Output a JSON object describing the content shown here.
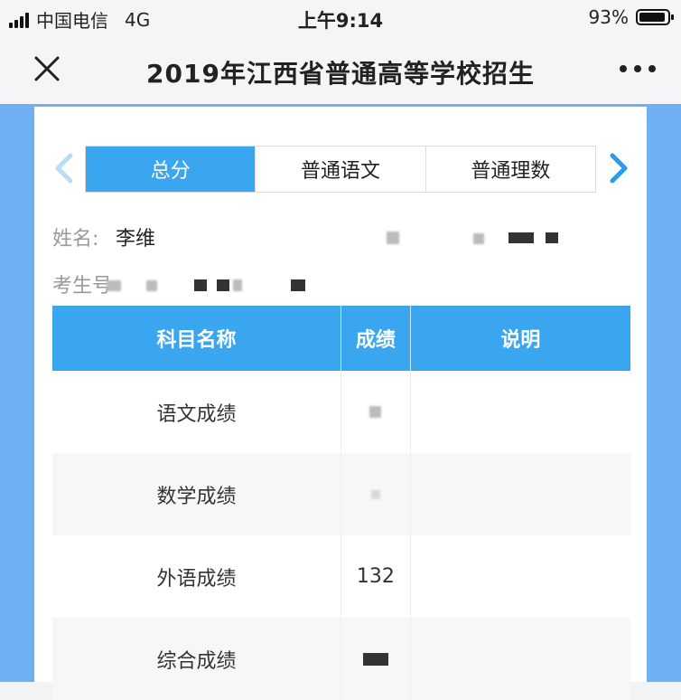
{
  "status_bar": {
    "carrier": "中国电信",
    "network": "4G",
    "time": "上午9:14",
    "battery": "93%",
    "battery_level": 0.93
  },
  "navbar": {
    "title": "2019年江西省普通高等学校招生",
    "close_icon": "close-icon",
    "more_icon": "more-icon"
  },
  "tabs": [
    "总分",
    "普通语文",
    "普通理数"
  ],
  "candidate": {
    "name_label": "姓名:",
    "name_value": "李维",
    "id_label": "考生号"
  },
  "table": {
    "headers": [
      "科目名称",
      "成绩",
      "说明"
    ],
    "rows": [
      {
        "subject": "语文成绩",
        "score": "",
        "note": ""
      },
      {
        "subject": "数学成绩",
        "score": "",
        "note": ""
      },
      {
        "subject": "外语成绩",
        "score": "132",
        "note": ""
      },
      {
        "subject": "综合成绩",
        "score": "",
        "note": ""
      }
    ]
  },
  "colors": {
    "accent": "#3aa6f0",
    "page_background": "#6fb0f2"
  }
}
